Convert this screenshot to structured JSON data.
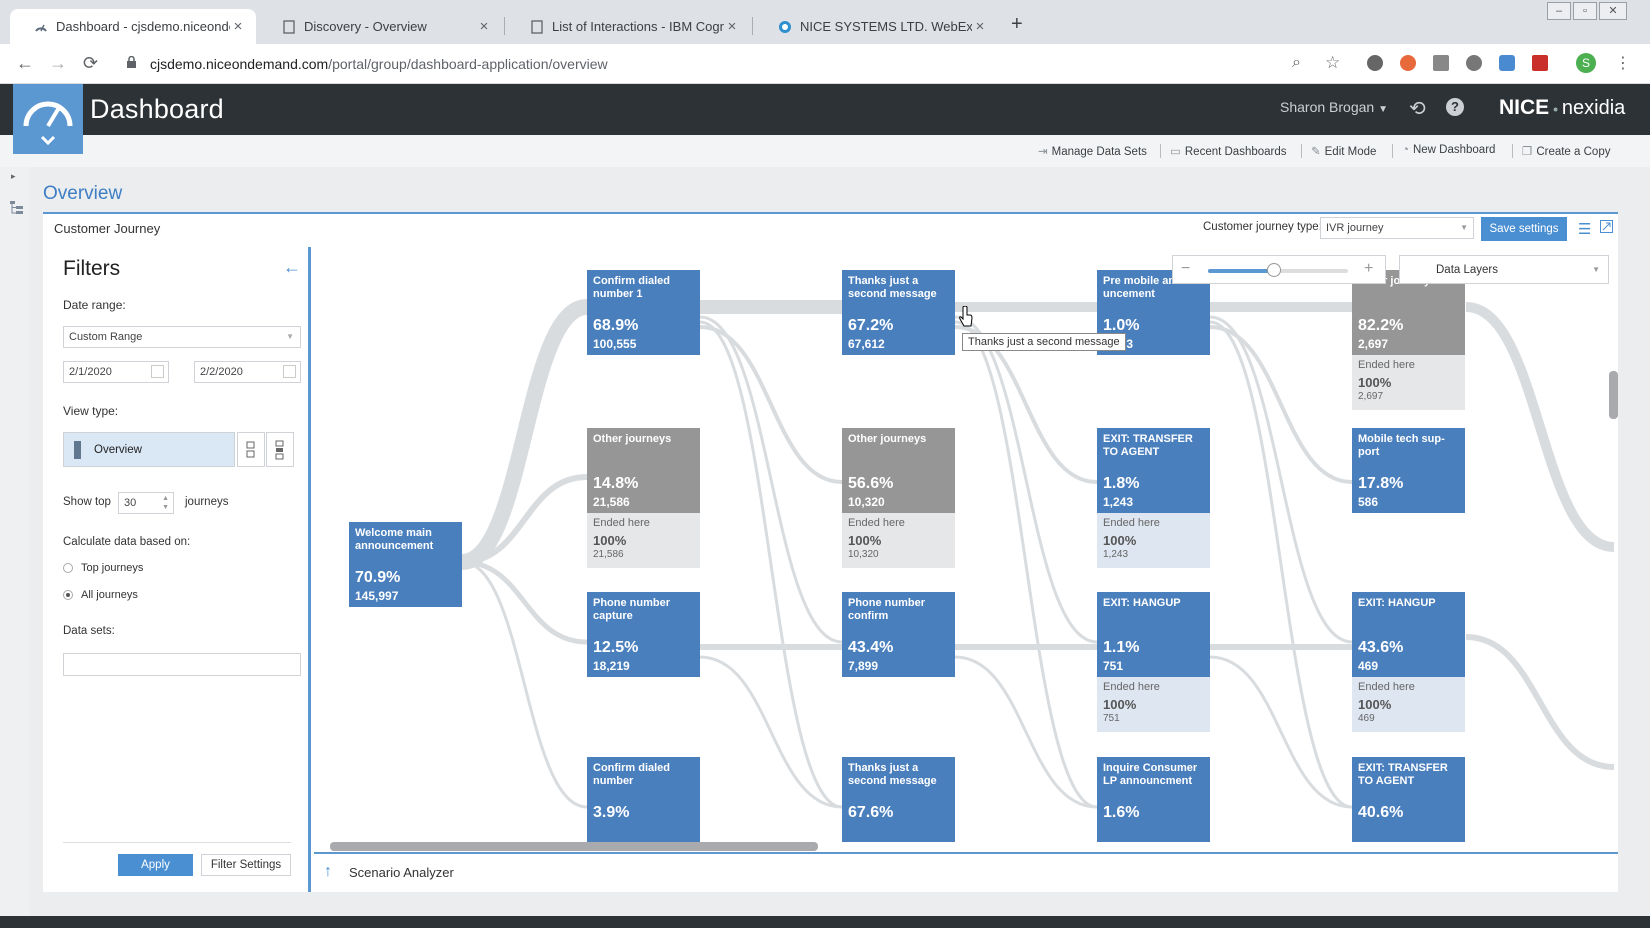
{
  "browser": {
    "tabs": [
      {
        "label": "Dashboard - cjsdemo.niceonden",
        "active": true
      },
      {
        "label": "Discovery - Overview",
        "active": false
      },
      {
        "label": "List of Interactions - IBM Cognos",
        "active": false
      },
      {
        "label": "NICE SYSTEMS LTD. WebEx Ente",
        "active": false
      }
    ],
    "url_host": "cjsdemo.niceondemand.com",
    "url_path": "/portal/group/dashboard-application/overview",
    "profile_initial": "S"
  },
  "app": {
    "title": "Dashboard",
    "user": "Sharon Brogan",
    "brand_nice": "NICE",
    "brand_nexidia": "nexidia",
    "actions": [
      "Manage Data Sets",
      "Recent Dashboards",
      "Edit Mode",
      "New Dashboard",
      "Create a Copy"
    ]
  },
  "page": {
    "title": "Overview",
    "panel_title": "Customer Journey",
    "journey_type_label": "Customer journey type:",
    "journey_type_value": "IVR journey",
    "save_label": "Save settings",
    "data_layers": "Data Layers",
    "zoom_fraction": 0.47,
    "tooltip": "Thanks just a second message",
    "scenario_label": "Scenario Analyzer"
  },
  "filters": {
    "title": "Filters",
    "date_range_label": "Date range:",
    "date_range_value": "Custom Range",
    "date_from": "2/1/2020",
    "date_to": "2/2/2020",
    "view_type_label": "View type:",
    "view_type_value": "Overview",
    "show_top_label": "Show top",
    "show_top_value": "30",
    "journeys_label": "journeys",
    "calc_label": "Calculate data based on:",
    "option_top": "Top journeys",
    "option_all": "All journeys",
    "selected_option": "All journeys",
    "data_sets_label": "Data sets:",
    "apply_label": "Apply",
    "filter_settings_label": "Filter Settings"
  },
  "journey": {
    "root": {
      "name": "Welcome main announcement",
      "pct": "70.9%",
      "count": "145,997"
    },
    "columns": [
      [
        {
          "name": "Confirm dialed number 1",
          "pct": "68.9%",
          "count": "100,555",
          "color": "blue"
        },
        {
          "name": "Other journeys",
          "pct": "14.8%",
          "count": "21,586",
          "color": "gray",
          "ended": {
            "label": "Ended here",
            "pct": "100%",
            "count": "21,586"
          }
        },
        {
          "name": "Phone number capture",
          "pct": "12.5%",
          "count": "18,219",
          "color": "blue"
        },
        {
          "name": "Confirm dialed number",
          "pct": "3.9%",
          "count": "",
          "color": "blue"
        }
      ],
      [
        {
          "name": "Thanks just a second message",
          "pct": "67.2%",
          "count": "67,612",
          "color": "blue"
        },
        {
          "name": "Other journeys",
          "pct": "56.6%",
          "count": "10,320",
          "color": "gray",
          "ended": {
            "label": "Ended here",
            "pct": "100%",
            "count": "10,320"
          }
        },
        {
          "name": "Phone number confirm",
          "pct": "43.4%",
          "count": "7,899",
          "color": "blue"
        },
        {
          "name": "Thanks just a second message",
          "pct": "67.6%",
          "count": "",
          "color": "blue"
        }
      ],
      [
        {
          "name": "Pre mobile anno-uncement",
          "pct": "1.0%",
          "count": "3,283",
          "color": "blue"
        },
        {
          "name": "EXIT: TRANSFER TO AGENT",
          "pct": "1.8%",
          "count": "1,243",
          "color": "blue",
          "ended": {
            "label": "Ended here",
            "pct": "100%",
            "count": "1,243"
          }
        },
        {
          "name": "EXIT: HANGUP",
          "pct": "1.1%",
          "count": "751",
          "color": "blue",
          "ended": {
            "label": "Ended here",
            "pct": "100%",
            "count": "751"
          }
        },
        {
          "name": "Inquire Consumer LP announcment",
          "pct": "1.6%",
          "count": "",
          "color": "blue"
        }
      ],
      [
        {
          "name": "Other journeys",
          "pct": "82.2%",
          "count": "2,697",
          "color": "gray",
          "ended": {
            "label": "Ended here",
            "pct": "100%",
            "count": "2,697"
          }
        },
        {
          "name": "Mobile tech sup-port",
          "pct": "17.8%",
          "count": "586",
          "color": "blue"
        },
        {
          "name": "EXIT: HANGUP",
          "pct": "43.6%",
          "count": "469",
          "color": "blue",
          "ended": {
            "label": "Ended here",
            "pct": "100%",
            "count": "469"
          }
        },
        {
          "name": "EXIT: TRANSFER TO AGENT",
          "pct": "40.6%",
          "count": "",
          "color": "blue"
        }
      ]
    ]
  }
}
